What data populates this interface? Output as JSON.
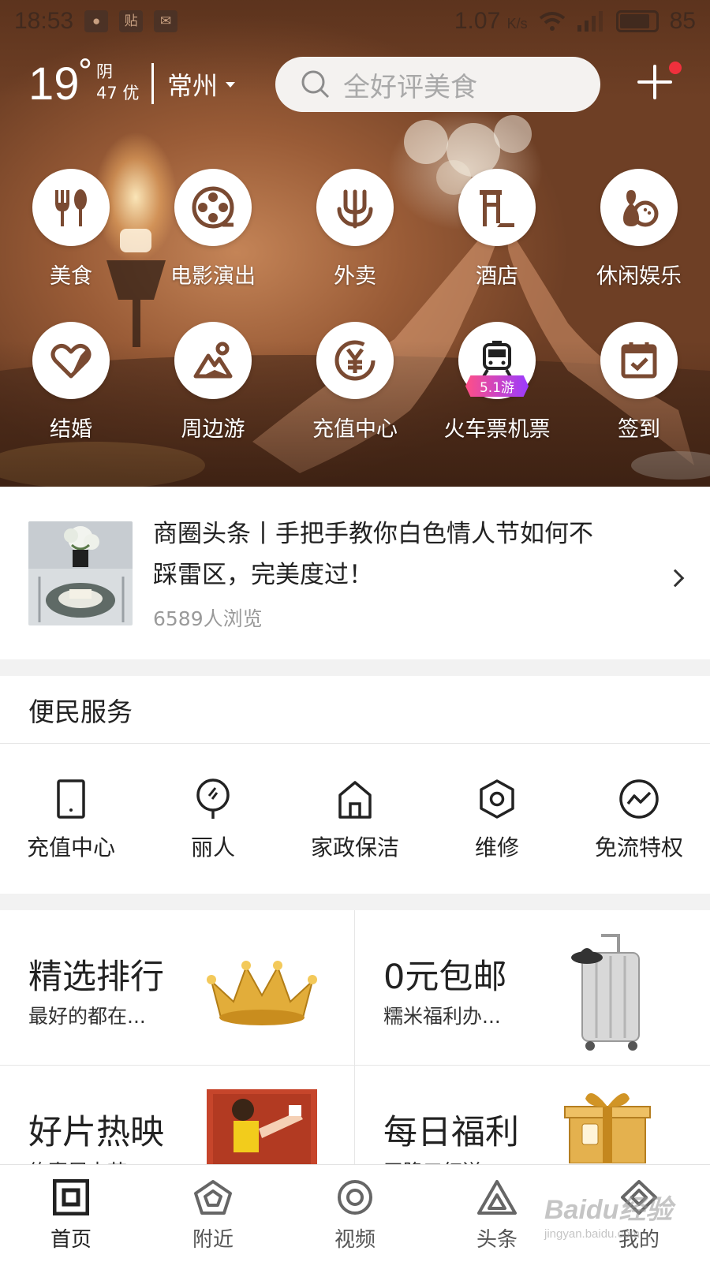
{
  "status_bar": {
    "time": "18:53",
    "notif_icons": [
      "qq-icon",
      "sticker-icon",
      "mail-icon"
    ],
    "sticker_icon_text": "贴",
    "net_speed": "1.07",
    "net_unit": "K/s",
    "battery": "85"
  },
  "weather": {
    "temp": "19",
    "deg": "°",
    "condition": "阴",
    "aqi": "47 优"
  },
  "location": {
    "city": "常州"
  },
  "search": {
    "placeholder": "全好评美食"
  },
  "categories": [
    {
      "label": "美食",
      "icon": "food-icon"
    },
    {
      "label": "电影演出",
      "icon": "film-reel-icon"
    },
    {
      "label": "外卖",
      "icon": "fork-icon"
    },
    {
      "label": "酒店",
      "icon": "hotel-icon"
    },
    {
      "label": "休闲娱乐",
      "icon": "bowling-icon"
    },
    {
      "label": "结婚",
      "icon": "heart-icon"
    },
    {
      "label": "周边游",
      "icon": "mountain-icon"
    },
    {
      "label": "充值中心",
      "icon": "yen-coin-icon"
    },
    {
      "label": "火车票机票",
      "icon": "train-icon",
      "badge": "5.1游"
    },
    {
      "label": "签到",
      "icon": "calendar-check-icon"
    }
  ],
  "news": {
    "title": "商圈头条丨手把手教你白色情人节如何不踩雷区，完美度过！",
    "views": "6589人浏览"
  },
  "services": {
    "title": "便民服务",
    "items": [
      {
        "label": "充值中心",
        "icon": "phone-icon"
      },
      {
        "label": "丽人",
        "icon": "mirror-icon"
      },
      {
        "label": "家政保洁",
        "icon": "house-icon"
      },
      {
        "label": "维修",
        "icon": "hex-nut-icon"
      },
      {
        "label": "免流特权",
        "icon": "pulse-icon"
      }
    ]
  },
  "promos": [
    {
      "title": "精选排行",
      "subtitle": "最好的都在...",
      "image": "crown-image"
    },
    {
      "title": "0元包邮",
      "subtitle": "糯米福利办...",
      "image": "suitcase-image"
    },
    {
      "title": "好片热映",
      "subtitle": "约惠周末节...",
      "image": "movie-poster-image"
    },
    {
      "title": "每日福利",
      "subtitle": "天降口红送...",
      "image": "gift-box-image"
    }
  ],
  "tabs": [
    {
      "label": "首页",
      "icon": "home-square-icon",
      "active": true
    },
    {
      "label": "附近",
      "icon": "pentagon-icon",
      "active": false
    },
    {
      "label": "视频",
      "icon": "target-icon",
      "active": false
    },
    {
      "label": "头条",
      "icon": "triangle-icon",
      "active": false
    },
    {
      "label": "我的",
      "icon": "diamond-icon",
      "active": false
    }
  ],
  "watermark": {
    "brand": "Baidu经验",
    "url": "jingyan.baidu.com"
  },
  "colors": {
    "accent_red": "#f0303c",
    "hero_brown": "#9a5c37",
    "icon_brown": "#7a4a32",
    "badge_pink": "#ff4f86",
    "badge_purple": "#9a3bff"
  }
}
